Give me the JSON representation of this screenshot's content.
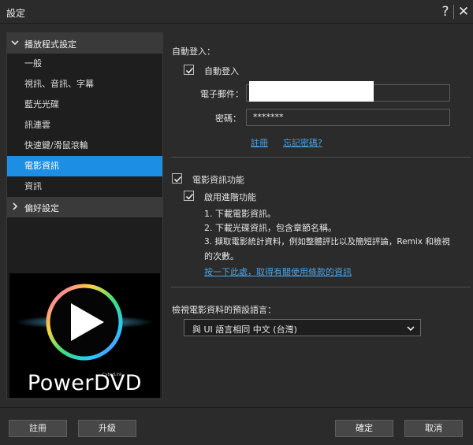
{
  "window": {
    "title": "設定",
    "help_glyph": "?",
    "close_glyph": "✕"
  },
  "sidebar": {
    "header_player": "播放程式設定",
    "items": [
      {
        "label": "一般"
      },
      {
        "label": "視訊、音訊、字幕"
      },
      {
        "label": "藍光光碟"
      },
      {
        "label": "訊連雲"
      },
      {
        "label": "快速鍵/滑鼠滾輪"
      },
      {
        "label": "電影資訊"
      },
      {
        "label": "資訊"
      }
    ],
    "active_index": 5,
    "header_prefs": "偏好設定",
    "logo_brand": "PowerDVD",
    "logo_small": "CyberLink"
  },
  "main": {
    "auto_login_section": "自動登入：",
    "auto_login_checkbox": "自動登入",
    "auto_login_checked": true,
    "email_label": "電子郵件：",
    "email_value": "",
    "password_label": "密碼：",
    "password_value": "*******",
    "register_link": "註冊",
    "forgot_link": "忘記密碼?",
    "movie_info_checkbox": "電影資訊功能",
    "movie_info_checked": true,
    "advanced_checkbox": "啟用進階功能",
    "advanced_checked": true,
    "feature_1": "1. 下載電影資訊。",
    "feature_2": "2. 下載光碟資訊，包含章節名稱。",
    "feature_3a": "3. 擷取電影統計資料，例如整體評比以及簡短評論，Remix 和檢視",
    "feature_3b": "的次數。",
    "terms_link": "按一下此處，取得有關使用條款的資訊",
    "language_label": "檢視電影資料的預設語言：",
    "language_value": "與 UI 語言相同 中文 (台灣)"
  },
  "footer": {
    "register_button": "註冊",
    "upgrade_button": "升級",
    "ok_button": "確定",
    "cancel_button": "取消"
  },
  "colors": {
    "accent": "#1c8fe4",
    "link": "#4aa3e6",
    "background": "#2b2b2b",
    "sidebar": "#1e1e1e"
  }
}
